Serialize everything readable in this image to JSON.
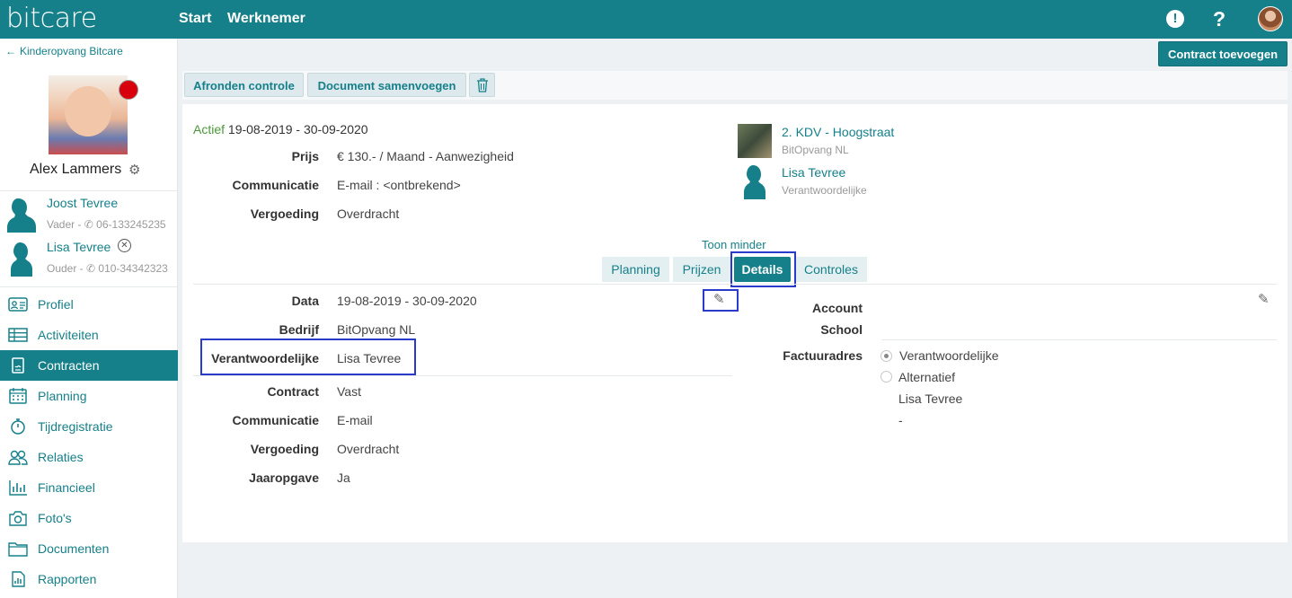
{
  "topbar": {
    "logo": "bitcare",
    "nav": [
      "Start",
      "Werknemer"
    ],
    "alert_glyph": "!",
    "help_glyph": "?"
  },
  "sidebar": {
    "back_label": "Kinderopvang Bitcare",
    "child_name": "Alex Lammers",
    "contacts": [
      {
        "name": "Joost Tevree",
        "info": "Vader - ✆ 06-133245235"
      },
      {
        "name": "Lisa Tevree",
        "info": "Ouder - ✆ 010-34342323"
      }
    ],
    "nav": [
      {
        "label": "Profiel",
        "icon": "id-card-icon"
      },
      {
        "label": "Activiteiten",
        "icon": "table-icon"
      },
      {
        "label": "Contracten",
        "icon": "contract-icon"
      },
      {
        "label": "Planning",
        "icon": "calendar-icon"
      },
      {
        "label": "Tijdregistratie",
        "icon": "stopwatch-icon"
      },
      {
        "label": "Relaties",
        "icon": "people-icon"
      },
      {
        "label": "Financieel",
        "icon": "bar-chart-icon"
      },
      {
        "label": "Foto's",
        "icon": "camera-icon"
      },
      {
        "label": "Documenten",
        "icon": "folder-icon"
      },
      {
        "label": "Rapporten",
        "icon": "report-icon"
      }
    ],
    "active_nav": "Contracten"
  },
  "actions": {
    "add_contract": "Contract toevoegen",
    "finish_check": "Afronden controle",
    "merge_document": "Document samenvoegen"
  },
  "contract": {
    "status_word": "Actief",
    "period": "19-08-2019 - 30-09-2020",
    "summary": [
      {
        "label": "Prijs",
        "value": "€ 130.- / Maand - Aanwezigheid"
      },
      {
        "label": "Communicatie",
        "value": "E-mail : <ontbrekend>"
      },
      {
        "label": "Vergoeding",
        "value": "Overdracht"
      }
    ],
    "location": {
      "name": "2. KDV - Hoogstraat",
      "sub": "BitOpvang NL"
    },
    "responsible": {
      "name": "Lisa Tevree",
      "sub": "Verantwoordelijke"
    },
    "toggle_label": "Toon minder",
    "tabs": [
      "Planning",
      "Prijzen",
      "Details",
      "Controles"
    ],
    "active_tab": "Details"
  },
  "details": {
    "left_top": [
      {
        "label": "Data",
        "value": "19-08-2019 - 30-09-2020"
      },
      {
        "label": "Bedrijf",
        "value": "BitOpvang NL"
      },
      {
        "label": "Verantwoordelijke",
        "value": "Lisa Tevree"
      }
    ],
    "left_bottom": [
      {
        "label": "Contract",
        "value": "Vast"
      },
      {
        "label": "Communicatie",
        "value": "E-mail"
      },
      {
        "label": "Vergoeding",
        "value": "Overdracht"
      },
      {
        "label": "Jaaropgave",
        "value": "Ja"
      }
    ],
    "right": {
      "account_label": "Account",
      "school_label": "School",
      "billing_label": "Factuuradres",
      "billing_options": [
        "Verantwoordelijke",
        "Alternatief"
      ],
      "billing_selected": "Verantwoordelijke",
      "billing_name": "Lisa Tevree",
      "billing_address": "-"
    }
  }
}
